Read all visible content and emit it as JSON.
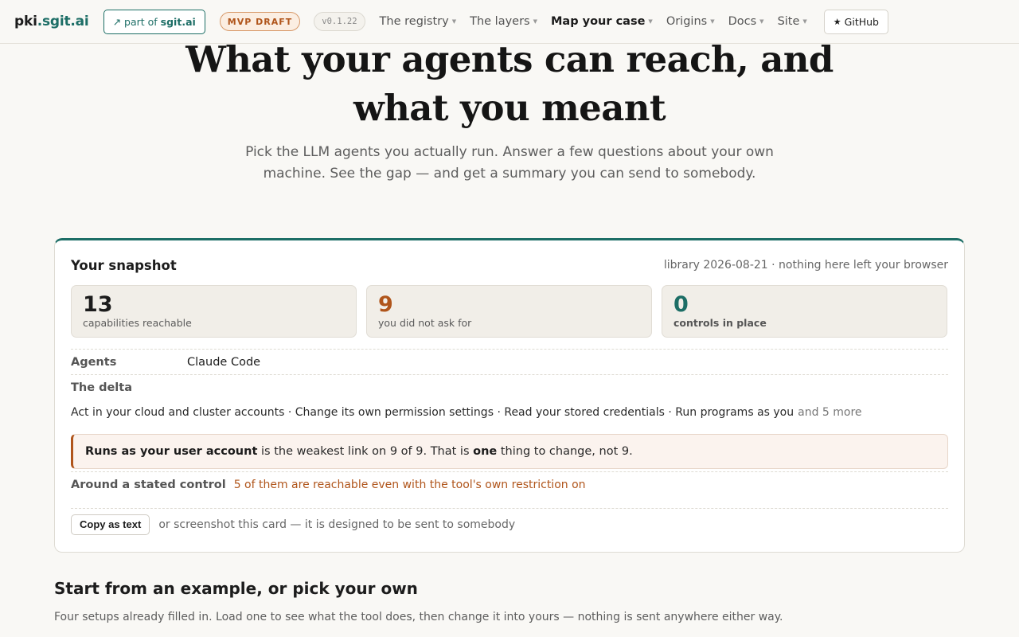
{
  "topbar": {
    "brand_name": "pki",
    "brand_tld": ".sgit.ai",
    "partof_prefix": "↗ part of",
    "partof_site": "sgit.ai",
    "draft_badge": "MVP DRAFT",
    "version_badge": "v0.1.22",
    "nav": [
      {
        "label": "The registry",
        "active": false
      },
      {
        "label": "The layers",
        "active": false
      },
      {
        "label": "Map your case",
        "active": true
      },
      {
        "label": "Origins",
        "active": false
      },
      {
        "label": "Docs",
        "active": false
      },
      {
        "label": "Site",
        "active": false
      }
    ],
    "github_label": "GitHub",
    "github_icon": "star-icon"
  },
  "hero": {
    "title": "What your agents can reach, and what you meant",
    "subtitle": "Pick the LLM agents you actually run. Answer a few questions about your own machine. See the gap — and get a summary you can send to somebody."
  },
  "snapshot": {
    "title": "Your snapshot",
    "meta": "library 2026-08-21 · nothing here left your browser",
    "stats": [
      {
        "value": "13",
        "label": "capabilities reachable",
        "color": "#1c1c1c"
      },
      {
        "value": "9",
        "label": "you did not ask for",
        "color": "#b0551b"
      },
      {
        "value": "0",
        "label": "controls in place",
        "color": "#1d6e66"
      }
    ],
    "agents_label": "Agents",
    "agents_value": "Claude Code",
    "delta_label": "The delta",
    "delta_items": "Act in your cloud and cluster accounts · Change its own permission settings · Read your stored credentials · Run programs as you",
    "delta_more": "and 5 more",
    "callout_bold": "Runs as your user account",
    "callout_mid": "is the weakest link on 9 of 9. That is",
    "callout_emph": "one",
    "callout_end": "thing to change, not 9.",
    "control_label": "Around a stated control",
    "control_text": "5 of them are reachable even with the tool's own restriction on",
    "copy_button": "Copy as text",
    "copy_note": "or screenshot this card — it is designed to be sent to somebody"
  },
  "examples": {
    "title": "Start from an example, or pick your own",
    "subtitle": "Four setups already filled in. Load one to see what the tool does, then change it into yours — nothing is sent anywhere either way."
  },
  "colors": {
    "accent": "#1d6e66",
    "warning": "#b0551b",
    "background": "#f9f8f5"
  }
}
